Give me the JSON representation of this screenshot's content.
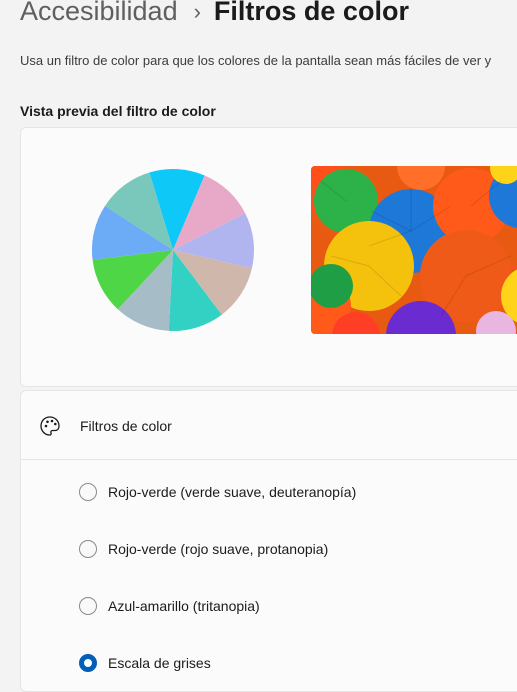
{
  "breadcrumb": {
    "parent": "Accesibilidad",
    "separator": "›",
    "current": "Filtros de color"
  },
  "description": "Usa un filtro de color para que los colores de la pantalla sean más fáciles de ver y",
  "preview": {
    "title": "Vista previa del filtro de color",
    "pie_colors": [
      "#0ec9f7",
      "#e8a9c9",
      "#b0b5ef",
      "#cfb8ab",
      "#33d1c4",
      "#a6bdc8",
      "#4ed646",
      "#6cabf5",
      "#79c8bb"
    ],
    "photo_icon": "colorful-paper-fans-photo"
  },
  "filters": {
    "label": "Filtros de color",
    "icon": "palette-icon",
    "options": [
      {
        "label": "Rojo-verde (verde suave, deuteranopía)",
        "selected": false
      },
      {
        "label": "Rojo-verde (rojo suave, protanopia)",
        "selected": false
      },
      {
        "label": "Azul-amarillo (tritanopia)",
        "selected": false
      },
      {
        "label": "Escala de grises",
        "selected": true
      }
    ]
  },
  "colors": {
    "accent": "#005fb8",
    "card": "#fbfbfb",
    "background": "#f3f3f3"
  }
}
